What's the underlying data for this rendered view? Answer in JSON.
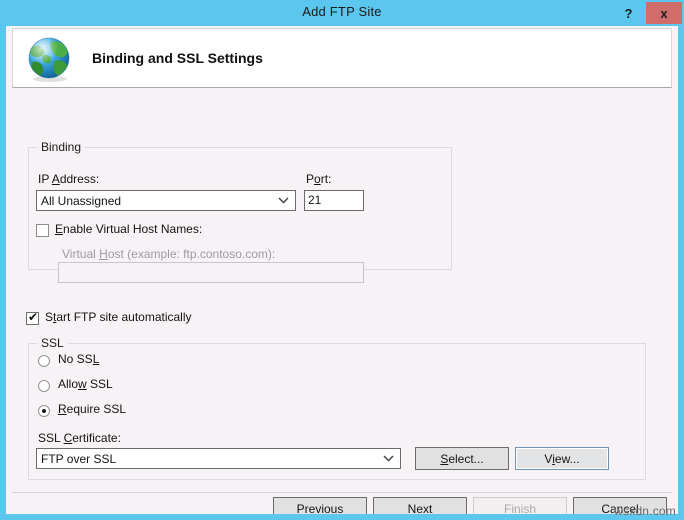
{
  "window": {
    "title": "Add FTP Site",
    "help_label": "?",
    "close_label": "x",
    "border_color": "#5bc6ee",
    "close_color": "#d06d6a",
    "body_color": "#f7f2f5"
  },
  "header": {
    "title": "Binding and SSL Settings",
    "icon": "globe-icon"
  },
  "binding": {
    "legend": "Binding",
    "ip_label": "IP Address:",
    "ip_value": "All Unassigned",
    "port_label": "Port:",
    "port_value": "21",
    "enable_virtual_host_label": "Enable Virtual Host Names:",
    "enable_virtual_host_checked": false,
    "virtual_host_label": "Virtual Host (example: ftp.contoso.com):",
    "virtual_host_value": "",
    "virtual_host_enabled": false
  },
  "start_ftp": {
    "label": "Start FTP site automatically",
    "checked": true,
    "tick": "✔"
  },
  "ssl": {
    "legend": "SSL",
    "options": [
      {
        "label": "No SSL",
        "selected": false
      },
      {
        "label": "Allow SSL",
        "selected": false
      },
      {
        "label": "Require SSL",
        "selected": true
      }
    ],
    "certificate_label": "SSL Certificate:",
    "certificate_value": "FTP over SSL",
    "select_button": "Select...",
    "view_button": "View..."
  },
  "footer": {
    "previous": "Previous",
    "next": "Next",
    "finish": "Finish",
    "cancel": "Cancel",
    "finish_disabled": true
  },
  "watermark": "wsxdn.com"
}
